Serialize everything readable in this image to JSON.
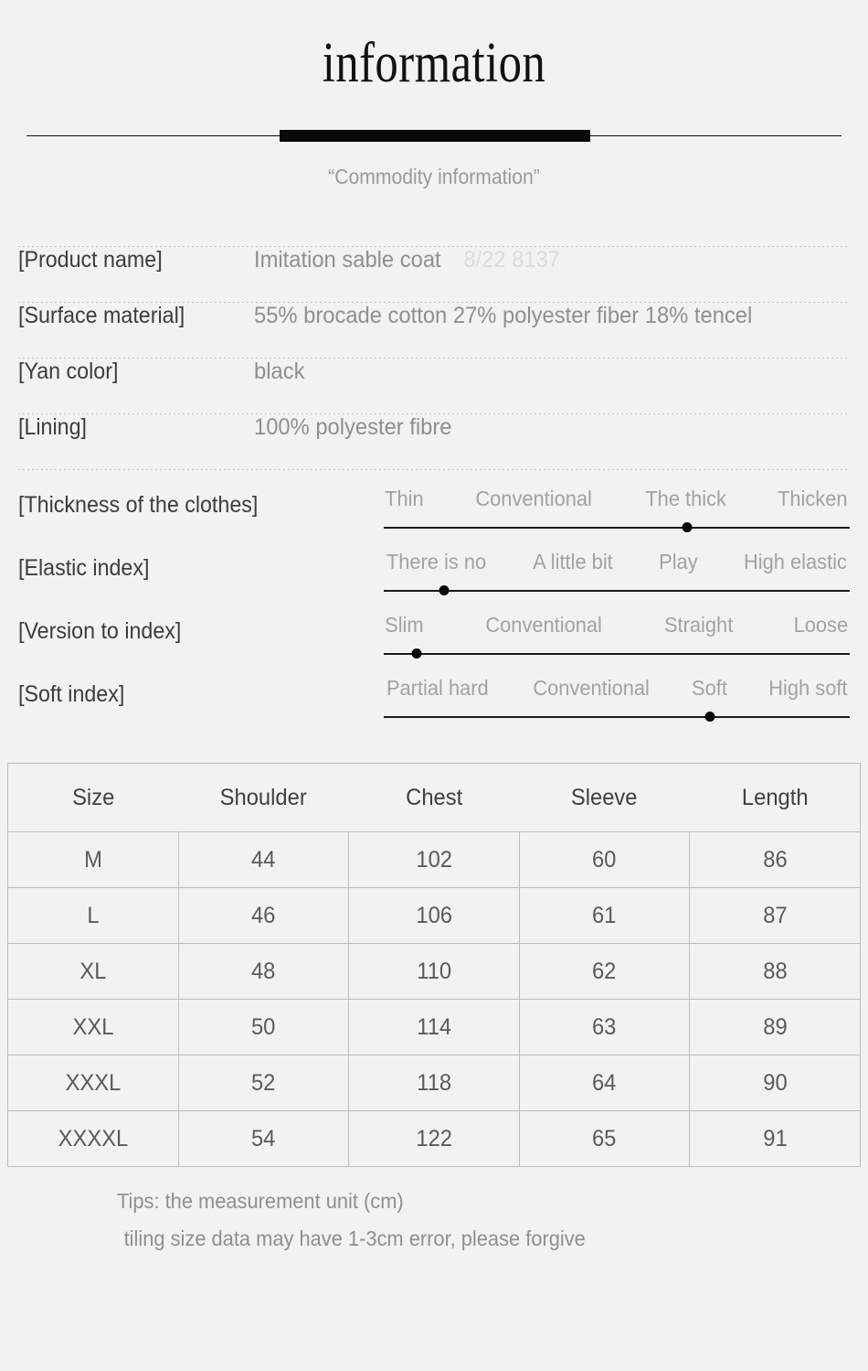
{
  "header": {
    "title": "information",
    "subtitle": "“Commodity information”"
  },
  "specs": [
    {
      "key": "[Product name]",
      "value": "Imitation sable coat",
      "code": "8/22 8137"
    },
    {
      "key": "[Surface material]",
      "value": "55% brocade cotton 27% polyester fiber 18% tencel",
      "code": ""
    },
    {
      "key": "[Yan color]",
      "value": "black",
      "code": ""
    },
    {
      "key": "[Lining]",
      "value": "100% polyester fibre",
      "code": ""
    }
  ],
  "sliders": [
    {
      "key": "[Thickness of the clothes]",
      "options": [
        "Thin",
        "Conventional",
        "The thick",
        "Thicken"
      ],
      "selected": "The thick",
      "position_percent": 65
    },
    {
      "key": "[Elastic index]",
      "options": [
        "There is no",
        "A little bit",
        "Play",
        "High elastic"
      ],
      "selected": "There is no",
      "position_percent": 13
    },
    {
      "key": "[Version to index]",
      "options": [
        "Slim",
        "Conventional",
        "Straight",
        "Loose"
      ],
      "selected": "Slim",
      "position_percent": 7
    },
    {
      "key": "[Soft index]",
      "options": [
        "Partial hard",
        "Conventional",
        "Soft",
        "High soft"
      ],
      "selected": "Soft",
      "position_percent": 70
    }
  ],
  "size_table": {
    "headers": [
      "Size",
      "Shoulder",
      "Chest",
      "Sleeve",
      "Length"
    ],
    "rows": [
      [
        "M",
        "44",
        "102",
        "60",
        "86"
      ],
      [
        "L",
        "46",
        "106",
        "61",
        "87"
      ],
      [
        "XL",
        "48",
        "110",
        "62",
        "88"
      ],
      [
        "XXL",
        "50",
        "114",
        "63",
        "89"
      ],
      [
        "XXXL",
        "52",
        "118",
        "64",
        "90"
      ],
      [
        "XXXXL",
        "54",
        "122",
        "65",
        "91"
      ]
    ]
  },
  "tips": {
    "line1": "Tips: the measurement unit (cm)",
    "line2": "tiling size data may have 1-3cm error, please forgive"
  },
  "colors": {
    "background": "#f2f2f2",
    "title": "#111111",
    "key_text": "#3c3c3c",
    "value_text": "#8f8f8f",
    "faded_code": "#dcdcdc",
    "rule": "#090909",
    "table_border": "#bdbdbd",
    "dot_marker": "#0a0a0a"
  }
}
